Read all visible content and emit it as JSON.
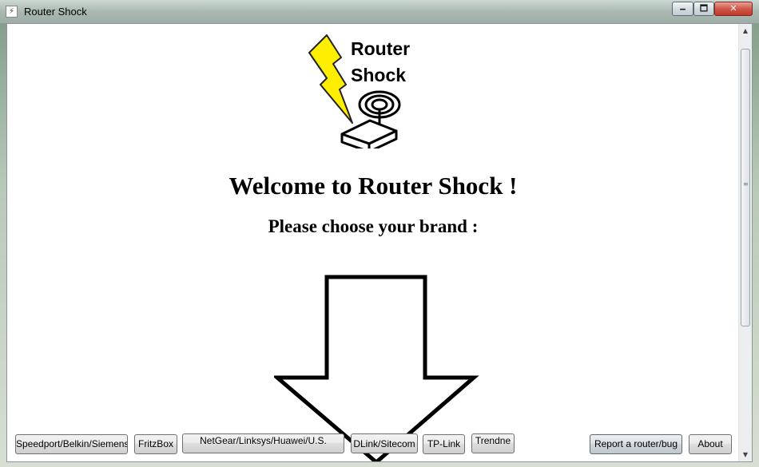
{
  "window": {
    "title": "Router Shock",
    "minimize": "🗕",
    "maximize": "🗖",
    "close": "✕"
  },
  "logo": {
    "line1": "Router",
    "line2": "Shock",
    "bolt_color": "#ffee00"
  },
  "main": {
    "welcome": "Welcome to Router Shock !",
    "prompt": "Please choose your brand :"
  },
  "brands": [
    {
      "label": "Speedport/Belkin/Siemens"
    },
    {
      "label": "FritzBox"
    },
    {
      "label": "NetGear/Linksys/Huawei/U.S."
    },
    {
      "label": "DLink/Sitecom"
    },
    {
      "label": "TP-Link"
    },
    {
      "label": "Trendne"
    }
  ],
  "actions": {
    "report": "Report a router/bug",
    "about": "About"
  },
  "scrollbar": {
    "up": "▲",
    "down": "▼",
    "grip": "≡"
  }
}
